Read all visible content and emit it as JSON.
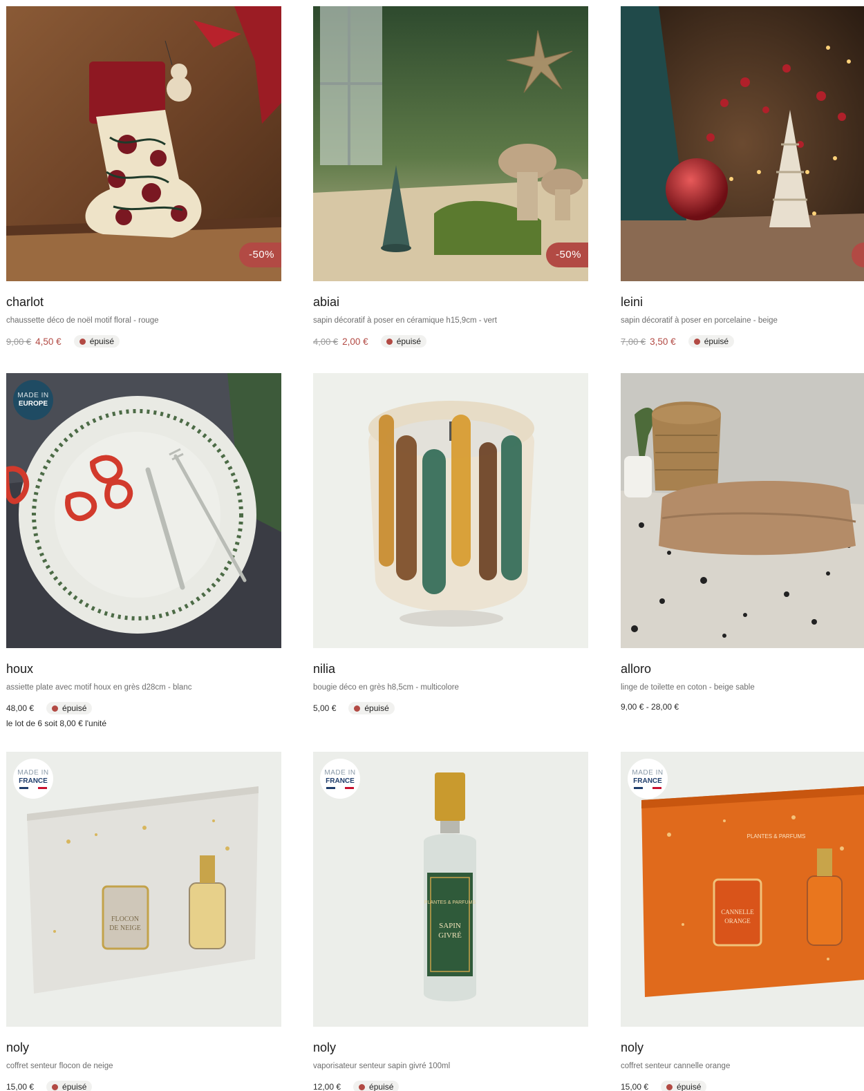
{
  "colors": {
    "sale": "#b24a44",
    "stock_dot": "#b24a44",
    "badge_europe": "#1f4b63",
    "muted_text": "#6d6d6d"
  },
  "products": [
    {
      "name": "charlot",
      "description": "chaussette déco de noël motif floral - rouge",
      "old_price": "9,00 €",
      "price": "4,50 €",
      "stock": "épuisé",
      "discount": "-50%",
      "image": "red floral christmas stocking hanging on wooden wall"
    },
    {
      "name": "abiai",
      "description": "sapin décoratif à poser en céramique h15,9cm - vert",
      "old_price": "4,00 €",
      "price": "2,00 €",
      "stock": "épuisé",
      "discount": "-50%",
      "image": "ceramic tree and mushrooms on moss table"
    },
    {
      "name": "leini",
      "description": "sapin décoratif à poser en porcelaine - beige",
      "old_price": "7,00 €",
      "price": "3,50 €",
      "stock": "épuisé",
      "image": "porcelain tree with red ornament and lights"
    },
    {
      "name": "houx",
      "description": "assiette plate avec motif houx en grès d28cm - blanc",
      "price": "48,00 €",
      "stock": "épuisé",
      "unit_note": "le lot de 6 soit 8,00 € l'unité",
      "badge": {
        "line1": "MADE IN",
        "line2": "EUROPE"
      },
      "image": "white holly plate with cutlery and red peppers"
    },
    {
      "name": "nilia",
      "description": "bougie déco en grès h8,5cm - multicolore",
      "price": "5,00 €",
      "stock": "épuisé",
      "image": "stoneware candle with painted stripes"
    },
    {
      "name": "alloro",
      "description": "linge de toilette en coton - beige sable",
      "price": "9,00 € - 28,00 €",
      "image": "folded beige towels on terrazzo shelf"
    },
    {
      "name": "noly",
      "description": "coffret senteur flocon de neige",
      "price": "15,00 €",
      "stock": "épuisé",
      "badge": {
        "line1": "MADE IN",
        "line2": "FRANCE"
      },
      "box_text": [
        "FLOCON",
        "DE NEIGE"
      ],
      "image": "white gift box with candle and spray"
    },
    {
      "name": "noly",
      "description": "vaporisateur senteur sapin givré 100ml",
      "price": "12,00 €",
      "stock": "épuisé",
      "badge": {
        "line1": "MADE IN",
        "line2": "FRANCE"
      },
      "box_text": [
        "PLANTES & PARFUMS",
        "SAPIN",
        "GIVRÉ"
      ],
      "image": "green room spray bottle"
    },
    {
      "name": "noly",
      "description": "coffret senteur cannelle orange",
      "price": "15,00 €",
      "stock": "épuisé",
      "badge": {
        "line1": "MADE IN",
        "line2": "FRANCE"
      },
      "box_text": [
        "PLANTES & PARFUMS",
        "CANNELLE",
        "ORANGE"
      ],
      "image": "orange gift box with candle and spray"
    }
  ]
}
